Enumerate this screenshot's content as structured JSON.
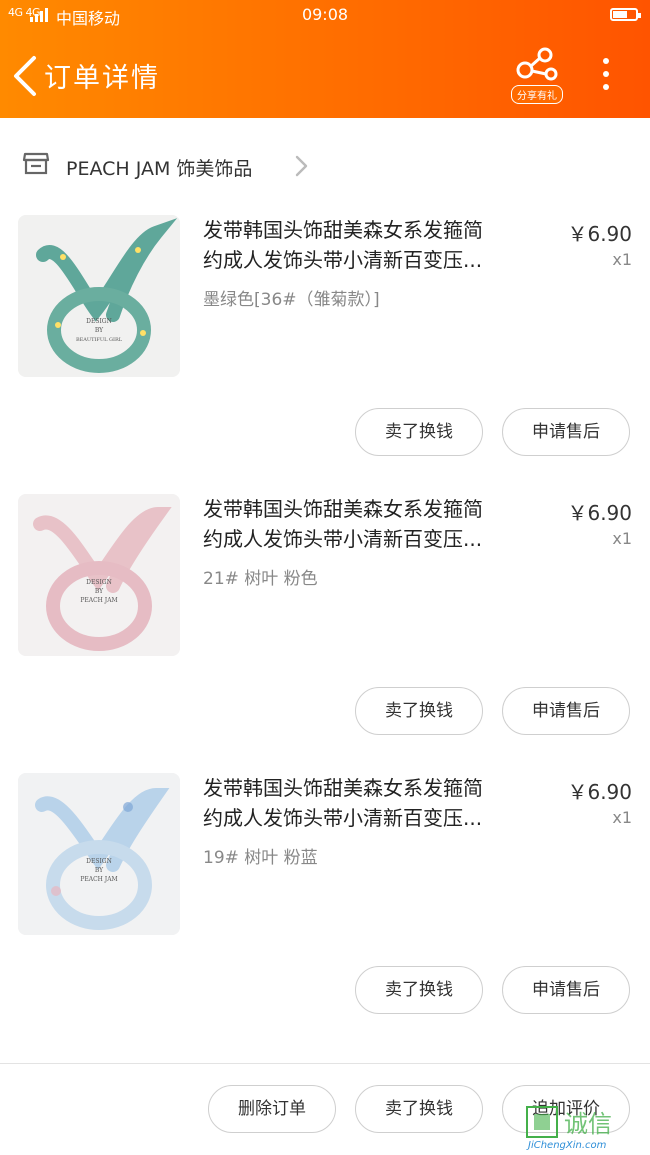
{
  "status_bar": {
    "network": "4G 4G",
    "carrier": "中国移动",
    "time": "09:08"
  },
  "header": {
    "title": "订单详情",
    "share_badge": "分享有礼",
    "back_icon": "chevron-left-icon",
    "share_icon": "share-icon",
    "more_icon": "more-vertical-icon",
    "accent_color": "#ff6a00"
  },
  "shop": {
    "name": "PEACH JAM 饰美饰品",
    "icon": "store-icon"
  },
  "items": [
    {
      "title_line1": "发带韩国头饰甜美森女系发箍简",
      "title_line2": "约成人发饰头带小清新百变压...",
      "price": "￥6.90",
      "qty": "x1",
      "variant": "墨绿色[36#（雏菊款）]",
      "thumb_label": "DESIGN\nBY\nBEAUTIFUL GIRL",
      "buttons": [
        "卖了换钱",
        "申请售后"
      ]
    },
    {
      "title_line1": "发带韩国头饰甜美森女系发箍简",
      "title_line2": "约成人发饰头带小清新百变压...",
      "price": "￥6.90",
      "qty": "x1",
      "variant": "21# 树叶 粉色",
      "thumb_label": "DESIGN\nBY\nPEACH JAM",
      "buttons": [
        "卖了换钱",
        "申请售后"
      ]
    },
    {
      "title_line1": "发带韩国头饰甜美森女系发箍简",
      "title_line2": "约成人发饰头带小清新百变压...",
      "price": "￥6.90",
      "qty": "x1",
      "variant": "19# 树叶 粉蓝",
      "thumb_label": "DESIGN\nBY\nPEACH JAM",
      "buttons": [
        "卖了换钱",
        "申请售后"
      ]
    }
  ],
  "bottom_bar": {
    "buttons": [
      "删除订单",
      "卖了换钱",
      "追加评价"
    ]
  },
  "watermark": {
    "cn": "诚信",
    "en": "JiChengXin.com"
  }
}
